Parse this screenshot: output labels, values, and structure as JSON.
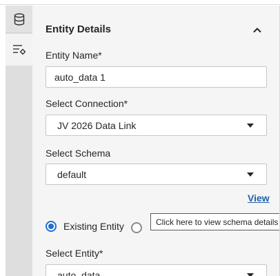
{
  "rail": {
    "items": [
      {
        "icon": "database-icon"
      },
      {
        "icon": "properties-icon"
      }
    ]
  },
  "section": {
    "title": "Entity Details",
    "collapse_icon": "chevron-up-icon"
  },
  "entity_name": {
    "label": "Entity Name*",
    "value": "auto_data 1"
  },
  "connection": {
    "label": "Select Connection*",
    "value": "JV 2026 Data Link"
  },
  "schema": {
    "label": "Select Schema",
    "value": "default",
    "view_link": "View"
  },
  "entity_type": {
    "existing_label": "Existing Entity",
    "selected": "existing"
  },
  "tooltip": {
    "text": "Click here to view schema details"
  },
  "entity": {
    "label": "Select Entity*",
    "value": "auto_data"
  },
  "colors": {
    "accent": "#1f6fd1",
    "link": "#1f5fa8",
    "panel_bg": "#f5f5f5",
    "rail_bg": "#dedede"
  }
}
